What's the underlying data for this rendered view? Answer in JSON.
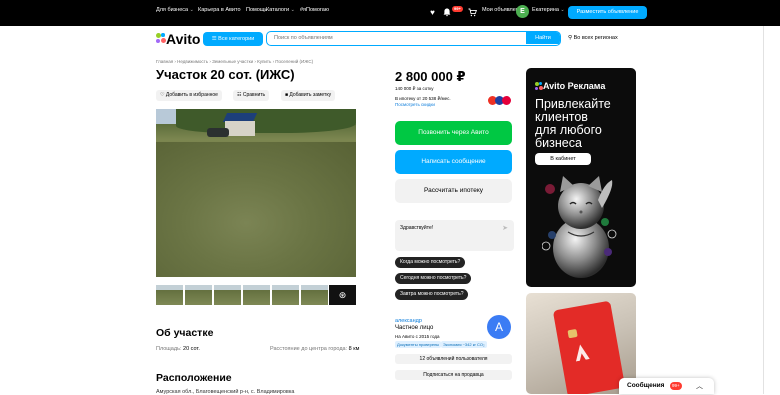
{
  "topbar": {
    "biz": "Для бизнеса",
    "career": "Карьера в Авито",
    "help": "Помощь",
    "catalogs": "Каталоги",
    "hashtag": "#яПомогаю",
    "my_ads": "Мои объявления",
    "user_initial": "Е",
    "user_name": "Екатерина",
    "post_ad": "Разместить объявление",
    "bell_badge": "99+"
  },
  "header": {
    "logo": "Avito",
    "all_categories": "Все категории",
    "search_placeholder": "Поиск по объявлениям",
    "search_button": "Найти",
    "region": "Во всех регионах"
  },
  "breadcrumbs": "Главная › Недвижимость › Земельные участки › Купить › Поселений (ИЖС)",
  "listing": {
    "title": "Участок 20 сот. (ИЖС)",
    "actions": {
      "favorite": "Добавить в избранное",
      "compare": "Сравнить",
      "note": "Добавить заметку"
    },
    "price": "2 800 000 ₽",
    "price_per_sotka": "140 000 ₽ за сотку",
    "mortgage": "В ипотеку от 20 538 ₽/мес.",
    "mortgage_link": "Посмотреть скидки",
    "btn_call": "Позвонить через Авито",
    "btn_write": "Написать сообщение",
    "btn_mortgage": "Рассчитать ипотеку"
  },
  "chat": {
    "greeting": "Здравствуйте!",
    "questions": [
      "Когда можно посмотреть?",
      "Сегодня можно посмотреть?",
      "Завтра можно посмотреть?"
    ]
  },
  "seller": {
    "name": "александр",
    "type": "Частное лицо",
    "since": "На Авито с 2015 года",
    "tag_docs": "Документы проверены",
    "tag_eco": "Экономия ~342 кг CO₂",
    "avatar": "А",
    "ads_count": "12 объявлений пользователя",
    "subscribe": "Подписаться на продавца"
  },
  "about": {
    "heading": "Об участке",
    "area_label": "Площадь:",
    "area_value": "20 сот.",
    "distance_label": "Расстояние до центра города:",
    "distance_value": "8 км"
  },
  "location": {
    "heading": "Расположение",
    "address": "Амурская обл., Благовещенский р-н, с. Владимировка"
  },
  "ad": {
    "logo": "Avito Реклама",
    "text": "Привлекайте\nклиентов\nдля любого\nбизнеса",
    "button": "В кабинет"
  },
  "messages": {
    "label": "Сообщения",
    "badge": "99+"
  },
  "colors": {
    "accent": "#00aaff",
    "green": "#00c843",
    "logo_dots": [
      "#97cf26",
      "#0af",
      "#ff6163",
      "#a169f7"
    ]
  }
}
